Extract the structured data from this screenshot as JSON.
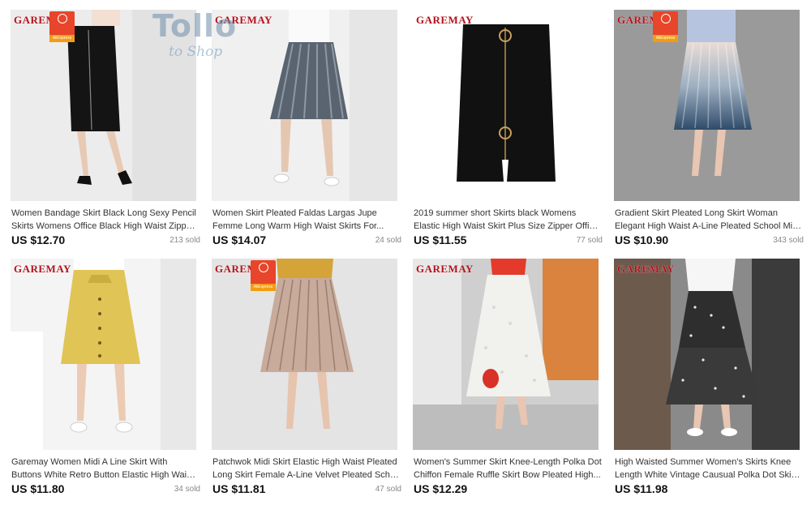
{
  "watermark": {
    "main": "Tollo",
    "sub": "to Shop"
  },
  "brand_text": "GAREMAY",
  "badge": {
    "top": "ALIEXPRESS",
    "bottom": "AliExpress"
  },
  "products": [
    {
      "title_line1": "Women Bandage Skirt Black Long Sexy Pencil",
      "title_line2": "Skirts Womens Office Black High Waist Zipper...",
      "price": "US $12.70",
      "sold": "213 sold",
      "icon": "black-pencil-skirt-photo"
    },
    {
      "title_line1": "Women Skirt Pleated Faldas Largas Jupe",
      "title_line2": "Femme Long Warm High Waist Skirts For...",
      "price": "US $14.07",
      "sold": "24 sold",
      "icon": "grey-pleated-skirt-photo"
    },
    {
      "title_line1": "2019 summer short Skirts black Womens",
      "title_line2": "Elastic High Waist Skirt Plus Size Zipper Office...",
      "price": "US $11.55",
      "sold": "77 sold",
      "icon": "black-zipper-skirt-photo"
    },
    {
      "title_line1": "Gradient Skirt Pleated Long Skirt Woman",
      "title_line2": "Elegant High Waist A-Line Pleated School Midi...",
      "price": "US $10.90",
      "sold": "343 sold",
      "icon": "gradient-pleated-skirt-photo"
    },
    {
      "title_line1": "Garemay Women Midi A Line Skirt With",
      "title_line2": "Buttons White Retro Button Elastic High Waist...",
      "price": "US $11.80",
      "sold": "34 sold",
      "icon": "yellow-button-skirt-photo"
    },
    {
      "title_line1": "Patchwok Midi Skirt Elastic High Waist Pleated",
      "title_line2": "Long Skirt Female A-Line Velvet Pleated Scho...",
      "price": "US $11.81",
      "sold": "47 sold",
      "icon": "champagne-pleated-skirt-photo"
    },
    {
      "title_line1": "Women's Summer Skirt Knee-Length Polka Dot",
      "title_line2": "Chiffon Female Ruffle Skirt Bow Pleated High...",
      "price": "US $12.29",
      "sold": "",
      "icon": "white-ruffle-skirt-photo"
    },
    {
      "title_line1": "High Waisted Summer Women's Skirts Knee",
      "title_line2": "Length White Vintage Causual Polka Dot Skirt...",
      "price": "US $11.98",
      "sold": "",
      "icon": "floral-tiered-skirt-photo"
    }
  ],
  "colors": {
    "price": "#111111",
    "brand": "#b3121b",
    "badge": "#e8452a"
  }
}
